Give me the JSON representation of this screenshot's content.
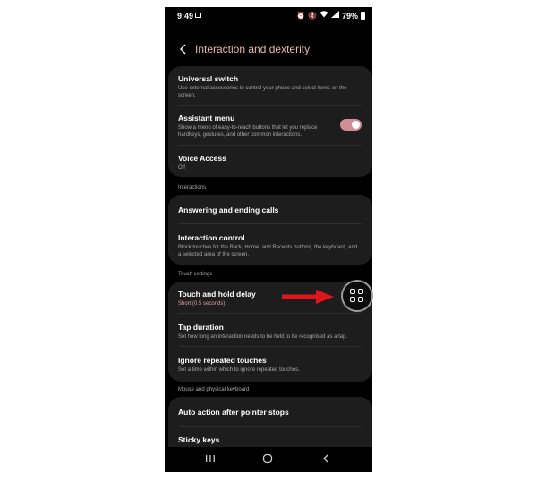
{
  "status_bar": {
    "time": "9:49",
    "icons": [
      "alarm-icon",
      "mute-icon",
      "wifi-icon",
      "signal-icon"
    ],
    "battery": "79%"
  },
  "header": {
    "title": "Interaction and dexterity"
  },
  "card1": {
    "items": [
      {
        "title": "Universal switch",
        "desc": "Use external accessories to control your phone and select items on the screen."
      },
      {
        "title": "Assistant menu",
        "desc": "Show a menu of easy-to-reach buttons that let you replace hardkeys, gestures, and other common interactions.",
        "toggle": "on"
      },
      {
        "title": "Voice Access",
        "desc": "Off"
      }
    ]
  },
  "sections": {
    "interactions": "Interactions",
    "touch_settings": "Touch settings",
    "mouse_keyboard": "Mouse and physical keyboard"
  },
  "card2": {
    "items": [
      {
        "title": "Answering and ending calls"
      },
      {
        "title": "Interaction control",
        "desc": "Block touches for the Back, Home, and Recents buttons, the keyboard, and a selected area of the screen."
      }
    ]
  },
  "card3": {
    "items": [
      {
        "title": "Touch and hold delay",
        "desc": "Short (0.5 seconds)"
      },
      {
        "title": "Tap duration",
        "desc": "Set how long an interaction needs to be held to be recognised as a tap."
      },
      {
        "title": "Ignore repeated touches",
        "desc": "Set a time within which to ignore repeated touches."
      }
    ]
  },
  "card4": {
    "items": [
      {
        "title": "Auto action after pointer stops"
      },
      {
        "title": "Sticky keys"
      }
    ]
  },
  "colors": {
    "accent": "#e6b7b2",
    "toggle_on": "#d08f95",
    "arrow": "#e0141b"
  }
}
